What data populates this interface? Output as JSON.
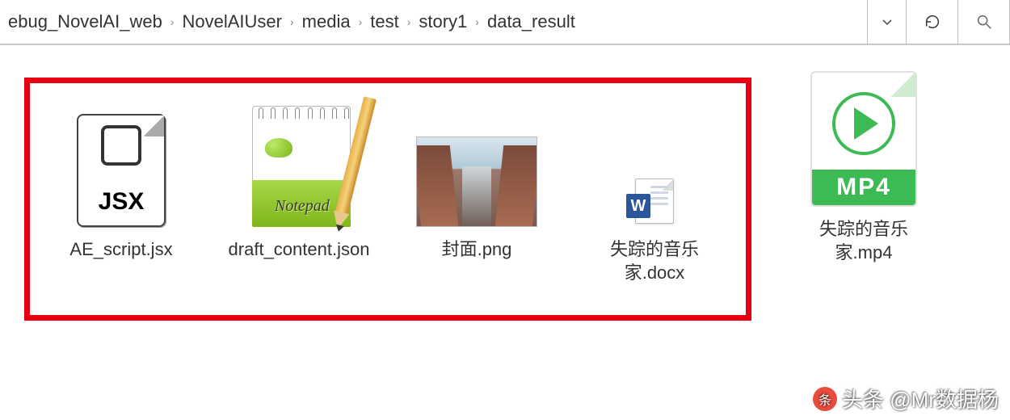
{
  "breadcrumb": {
    "items": [
      {
        "label": "ebug_NovelAI_web"
      },
      {
        "label": "NovelAIUser"
      },
      {
        "label": "media"
      },
      {
        "label": "test"
      },
      {
        "label": "story1"
      },
      {
        "label": "data_result"
      }
    ]
  },
  "files": {
    "highlighted": [
      {
        "name": "AE_script.jsx",
        "type": "jsx",
        "badge": "JSX"
      },
      {
        "name": "draft_content.json",
        "type": "notepadpp",
        "badge": "Notepad"
      },
      {
        "name": "封面.png",
        "type": "png"
      },
      {
        "name": "失踪的音乐家.docx",
        "type": "docx",
        "badge": "W"
      }
    ],
    "outside": [
      {
        "name": "失踪的音乐家.mp4",
        "type": "mp4",
        "badge": "MP4"
      }
    ]
  },
  "watermark": "头条 @Mr数据杨"
}
